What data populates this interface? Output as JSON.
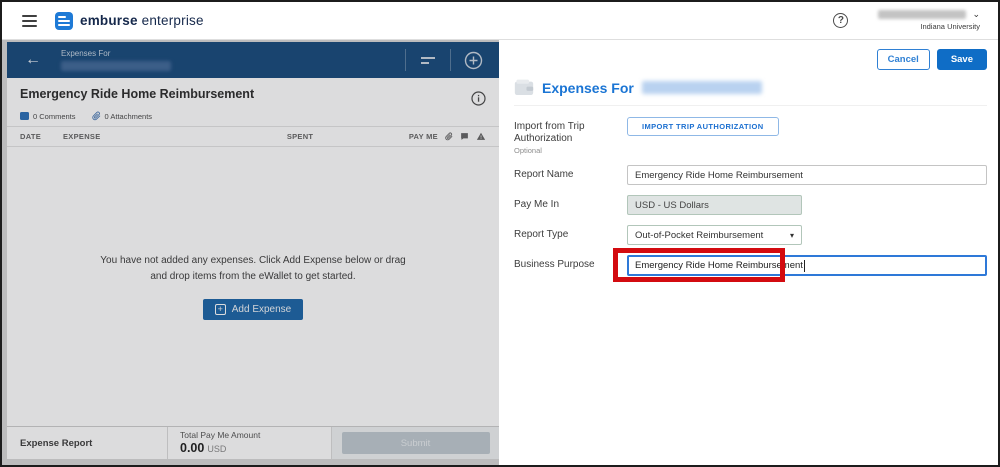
{
  "topbar": {
    "brand": "emburse",
    "brand_suffix": "enterprise",
    "help_glyph": "?",
    "org": "Indiana University",
    "chevron_glyph": "⌄"
  },
  "left_panel": {
    "header": {
      "back_glyph": "←",
      "eyebrow": "Expenses For"
    },
    "report_title": "Emergency Ride Home Reimbursement",
    "comments": "0 Comments",
    "attachments": "0 Attachments",
    "table_headers": {
      "date": "DATE",
      "expense": "EXPENSE",
      "spent": "SPENT",
      "pay_me": "PAY ME"
    },
    "empty_state_line1": "You have not added any expenses. Click Add Expense below or drag",
    "empty_state_line2": "and drop items from the eWallet to get started.",
    "add_expense_label": "Add Expense",
    "add_expense_plus": "+",
    "footer": {
      "report_label": "Expense Report",
      "total_label": "Total Pay Me Amount",
      "total_value": "0.00",
      "currency": "USD",
      "submit_label": "Submit"
    }
  },
  "right_panel": {
    "cancel_label": "Cancel",
    "save_label": "Save",
    "title": "Expenses For",
    "form": {
      "import_label": "Import from Trip Authorization",
      "import_optional": "Optional",
      "import_button": "IMPORT TRIP AUTHORIZATION",
      "report_name_label": "Report Name",
      "report_name_value": "Emergency Ride Home Reimbursement",
      "pay_me_in_label": "Pay Me In",
      "pay_me_in_value": "USD - US Dollars",
      "report_type_label": "Report Type",
      "report_type_value": "Out-of-Pocket Reimbursement",
      "report_type_arrow": "▾",
      "business_purpose_label": "Business Purpose",
      "business_purpose_value": "Emergency Ride Home Reimbursement"
    }
  },
  "colors": {
    "brand_navy": "#15284b",
    "header_blue": "#174a7c",
    "accent_blue": "#0f6dc6",
    "link_blue": "#1b75d4",
    "annotation_red": "#d30b10",
    "readonly_gray": "#dfe4e3"
  }
}
